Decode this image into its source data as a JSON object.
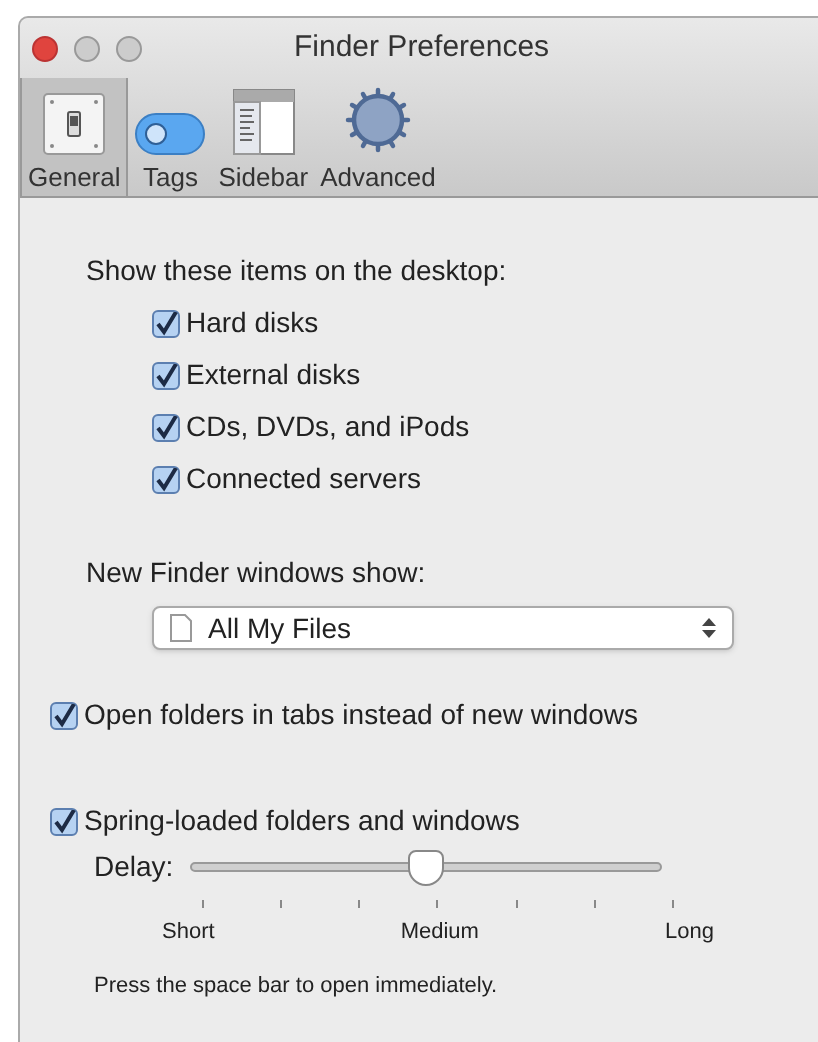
{
  "window": {
    "title": "Finder Preferences"
  },
  "tabs": [
    {
      "label": "General",
      "kind": "switch",
      "selected": true
    },
    {
      "label": "Tags",
      "kind": "tag",
      "selected": false
    },
    {
      "label": "Sidebar",
      "kind": "sidebar",
      "selected": false
    },
    {
      "label": "Advanced",
      "kind": "gear",
      "selected": false
    }
  ],
  "desktop": {
    "heading": "Show these items on the desktop:",
    "items": [
      {
        "label": "Hard disks",
        "checked": true
      },
      {
        "label": "External disks",
        "checked": true
      },
      {
        "label": "CDs, DVDs, and iPods",
        "checked": true
      },
      {
        "label": "Connected servers",
        "checked": true
      }
    ]
  },
  "new_windows": {
    "label": "New Finder windows show:",
    "value": "All My Files"
  },
  "open_in_tabs": {
    "label": "Open folders in tabs instead of new windows",
    "checked": true
  },
  "spring_loaded": {
    "label": "Spring-loaded folders and windows",
    "checked": true
  },
  "delay": {
    "label": "Delay:",
    "level": 0.5,
    "tick_labels": [
      "Short",
      "Medium",
      "Long"
    ]
  },
  "hint": "Press the space bar to open immediately."
}
